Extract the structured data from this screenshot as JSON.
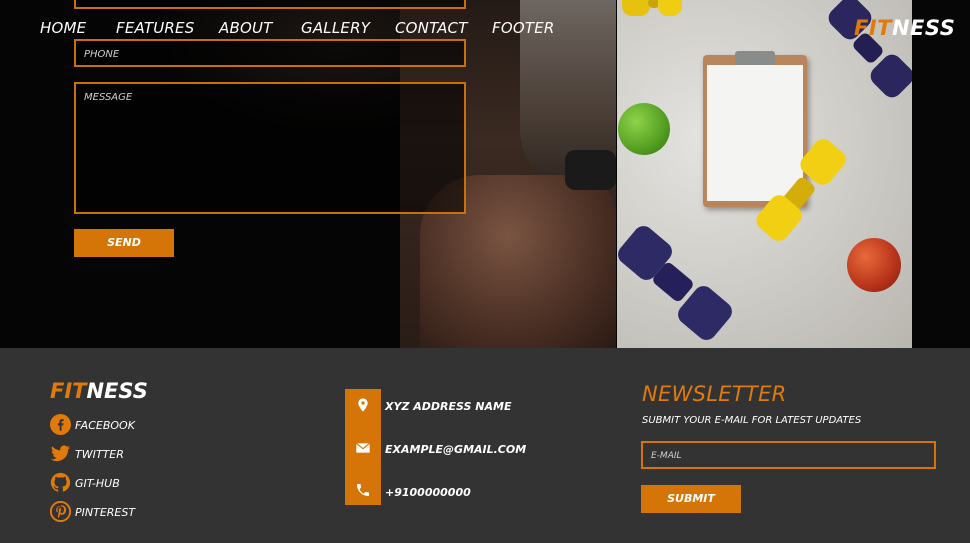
{
  "nav": {
    "items": [
      "HOME",
      "FEATURES",
      "ABOUT",
      "GALLERY",
      "CONTACT",
      "FOOTER"
    ],
    "brand_fit": "FIT",
    "brand_ness": "NESS"
  },
  "form": {
    "phone_placeholder": "PHONE",
    "message_placeholder": "MESSAGE",
    "send_label": "SEND"
  },
  "footer": {
    "brand_fit": "FIT",
    "brand_ness": "NESS",
    "social": [
      {
        "label": "FACEBOOK",
        "icon": "facebook-icon"
      },
      {
        "label": "TWITTER",
        "icon": "twitter-icon"
      },
      {
        "label": "GIT-HUB",
        "icon": "github-icon"
      },
      {
        "label": "PINTEREST",
        "icon": "pinterest-icon"
      }
    ],
    "contact": [
      {
        "text": "XYZ ADDRESS NAME",
        "icon": "map-pin-icon"
      },
      {
        "text": "EXAMPLE@GMAIL.COM",
        "icon": "envelope-icon"
      },
      {
        "text": "+9100000000",
        "icon": "phone-icon"
      }
    ],
    "newsletter": {
      "title": "NEWSLETTER",
      "subtitle": "SUBMIT YOUR E-MAIL FOR LATEST UPDATES",
      "email_placeholder": "E-MAIL",
      "submit_label": "SUBMIT"
    }
  },
  "colors": {
    "accent": "#d67507",
    "footer_bg": "#333333",
    "hero_bg": "#050505"
  }
}
